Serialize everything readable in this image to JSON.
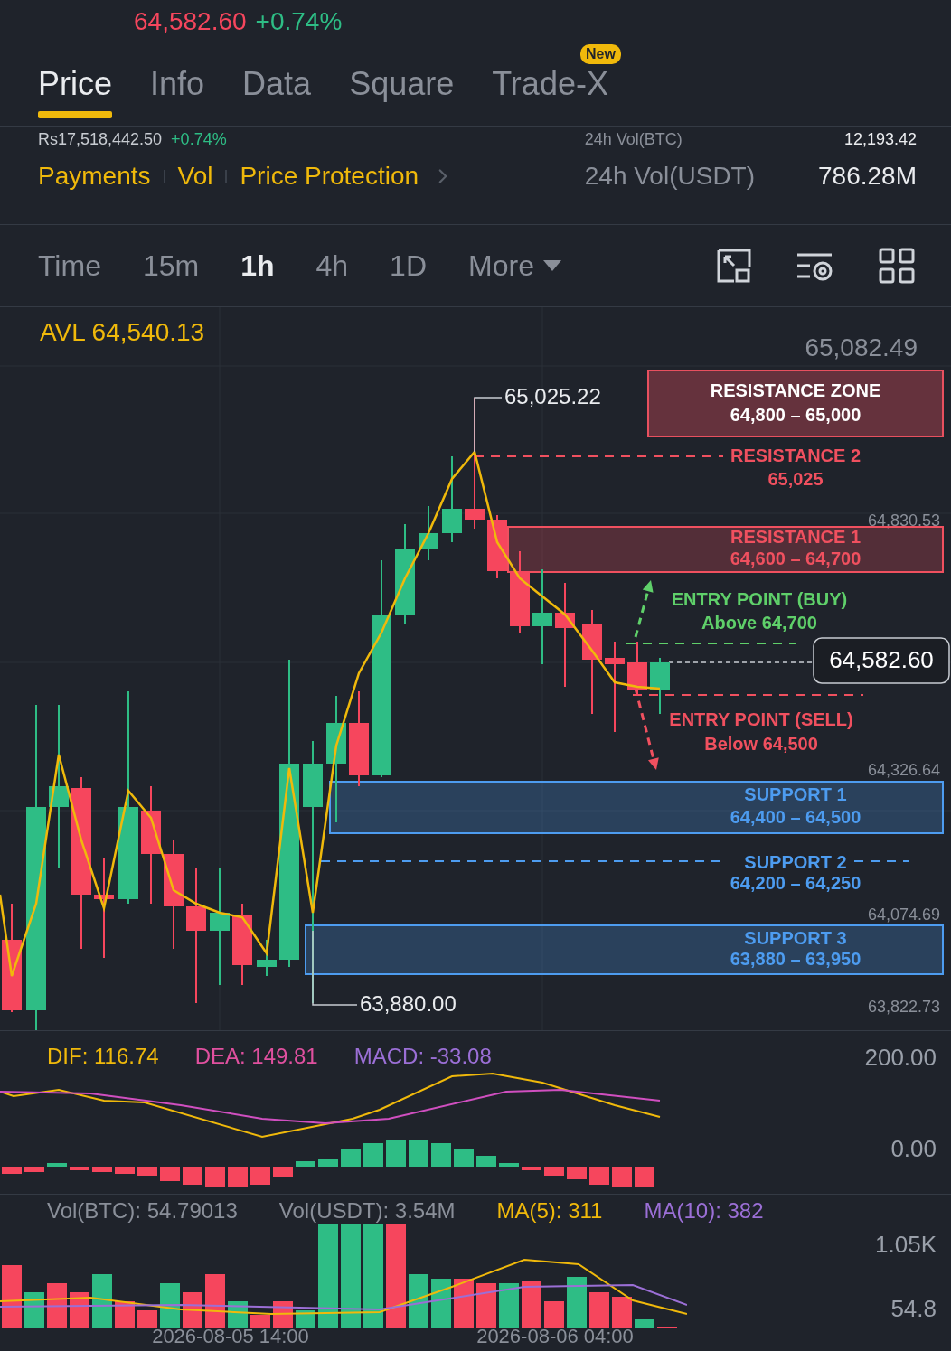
{
  "header": {
    "price": "64,582.60",
    "change": "+0.74%"
  },
  "tabs": [
    {
      "label": "Price",
      "selected": true
    },
    {
      "label": "Info",
      "selected": false
    },
    {
      "label": "Data",
      "selected": false
    },
    {
      "label": "Square",
      "selected": false
    },
    {
      "label": "Trade-X",
      "selected": false,
      "badge": "New"
    }
  ],
  "summary": {
    "fiat_price": "Rs17,518,442.50",
    "fiat_change": "+0.74%",
    "links": [
      "Payments",
      "Vol",
      "Price Protection"
    ],
    "stats": [
      {
        "label": "24h Vol(BTC)",
        "value": "12,193.42"
      },
      {
        "label": "24h Vol(USDT)",
        "value": "786.28M"
      }
    ]
  },
  "intervals": [
    {
      "label": "Time",
      "selected": false
    },
    {
      "label": "15m",
      "selected": false
    },
    {
      "label": "1h",
      "selected": true
    },
    {
      "label": "4h",
      "selected": false
    },
    {
      "label": "1D",
      "selected": false
    }
  ],
  "more": "More",
  "chart": {
    "avl": "AVL 64,540.13",
    "price_axis": [
      "65,082.49",
      "64,830.53",
      "64,326.64",
      "64,074.69",
      "63,822.73"
    ],
    "high_marker": "65,025.22",
    "low_marker": "63,880.00",
    "last_price": "64,582.60",
    "annotations": [
      {
        "kind": "zone_box",
        "color": "#e8505f",
        "title": "RESISTANCE ZONE",
        "range": "64,800 – 65,000"
      },
      {
        "kind": "line",
        "color": "#f0505f",
        "title": "RESISTANCE 2",
        "range": "65,025"
      },
      {
        "kind": "zone_band",
        "color": "#f0505f",
        "title": "RESISTANCE 1",
        "range": "64,600 – 64,700"
      },
      {
        "kind": "entry_up",
        "color": "#5fd06a",
        "title": "ENTRY POINT (BUY)",
        "range": "Above 64,700"
      },
      {
        "kind": "entry_down",
        "color": "#f0505f",
        "title": "ENTRY POINT (SELL)",
        "range": "Below 64,500"
      },
      {
        "kind": "zone_band",
        "color": "#4d9cf0",
        "title": "SUPPORT 1",
        "range": "64,400 – 64,500"
      },
      {
        "kind": "line",
        "color": "#4d9cf0",
        "title": "SUPPORT 2",
        "range": "64,200 – 64,250"
      },
      {
        "kind": "zone_band",
        "color": "#4d9cf0",
        "title": "SUPPORT 3",
        "range": "63,880 – 63,950"
      }
    ]
  },
  "macd": {
    "labels": [
      {
        "text": "DIF: 116.74",
        "color": "#f0b90b"
      },
      {
        "text": "DEA: 149.81",
        "color": "#e0509f"
      },
      {
        "text": "MACD: -33.08",
        "color": "#9b6fd6"
      }
    ],
    "axis": [
      "200.00",
      "0.00"
    ]
  },
  "volume": {
    "labels": [
      {
        "text": "Vol(BTC): 54.79013",
        "color": "#8a8f99"
      },
      {
        "text": "Vol(USDT): 3.54M",
        "color": "#8a8f99"
      },
      {
        "text": "MA(5): 311",
        "color": "#f0b90b"
      },
      {
        "text": "MA(10): 382",
        "color": "#9b6fd6"
      }
    ],
    "axis": [
      "1.05K",
      "54.8"
    ],
    "dates": [
      "2026-08-05 14:00",
      "2026-08-06 04:00"
    ]
  }
}
